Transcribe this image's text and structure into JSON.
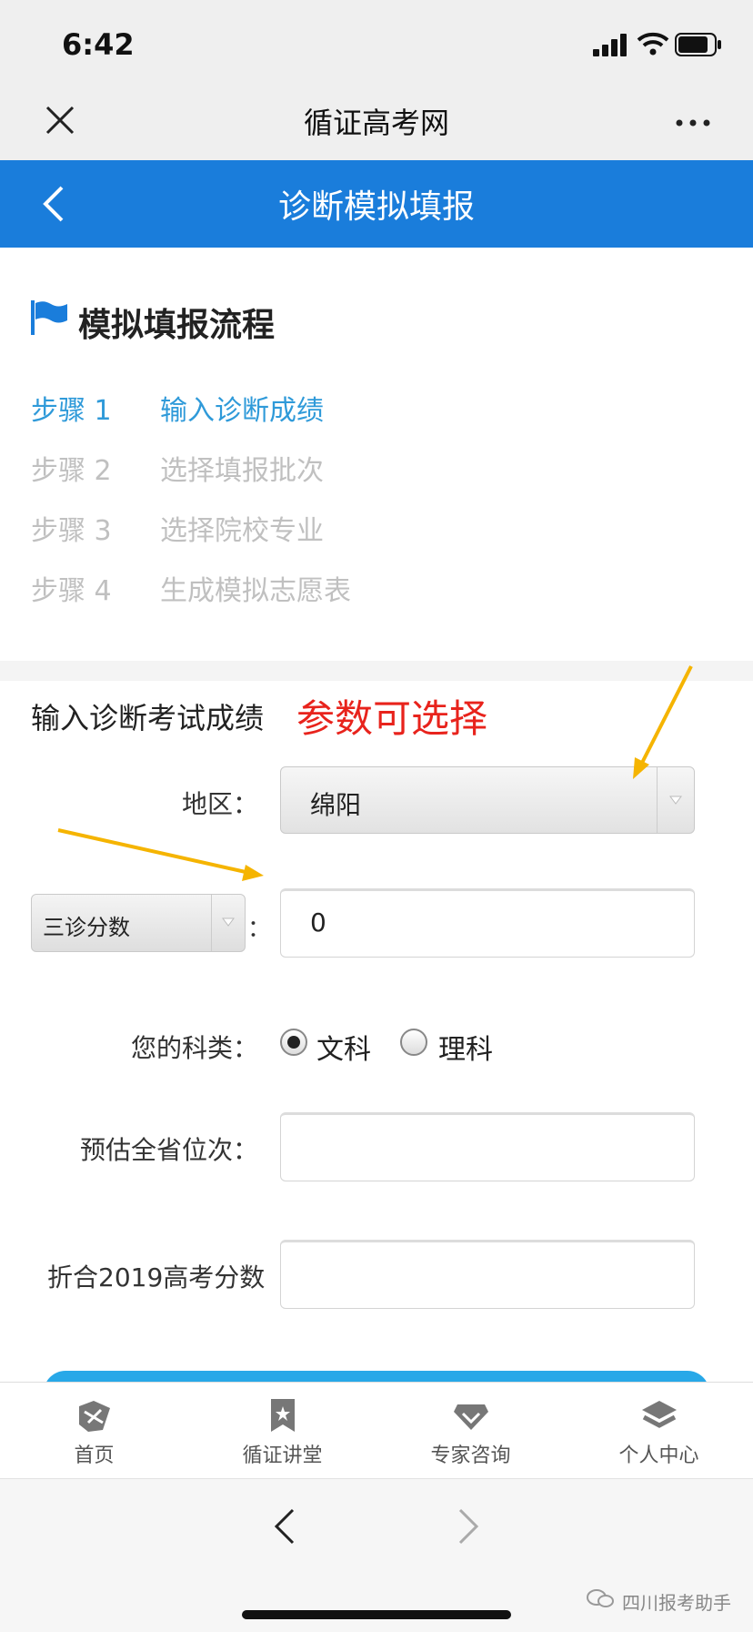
{
  "status": {
    "time": "6:42"
  },
  "nav": {
    "title": "循证高考网"
  },
  "header": {
    "title": "诊断模拟填报"
  },
  "process": {
    "title": "模拟填报流程",
    "steps": [
      {
        "num": "步骤 1",
        "label": "输入诊断成绩"
      },
      {
        "num": "步骤 2",
        "label": "选择填报批次"
      },
      {
        "num": "步骤 3",
        "label": "选择院校专业"
      },
      {
        "num": "步骤 4",
        "label": "生成模拟志愿表"
      }
    ]
  },
  "form": {
    "title": "输入诊断考试成绩",
    "annotation": "参数可选择",
    "region_label": "地区：",
    "region_value": "绵阳",
    "exam_select_value": "三诊分数",
    "colon": "：",
    "score_value": "0",
    "subject_label": "您的科类：",
    "subject_options": [
      "文科",
      "理科"
    ],
    "subject_selected": "文科",
    "rank_label": "预估全省位次：",
    "converted_label": "折合2019高考分数"
  },
  "tabbar": {
    "items": [
      {
        "label": "首页",
        "icon": "home-icon"
      },
      {
        "label": "循证讲堂",
        "icon": "bookmark-icon"
      },
      {
        "label": "专家咨询",
        "icon": "diamond-icon"
      },
      {
        "label": "个人中心",
        "icon": "layers-icon"
      }
    ]
  },
  "watermark": "四川报考助手",
  "colors": {
    "header_blue": "#1a7ddb",
    "active_step": "#2f9ad9",
    "annotation_red": "#e8231c",
    "arrow": "#f5b400"
  }
}
